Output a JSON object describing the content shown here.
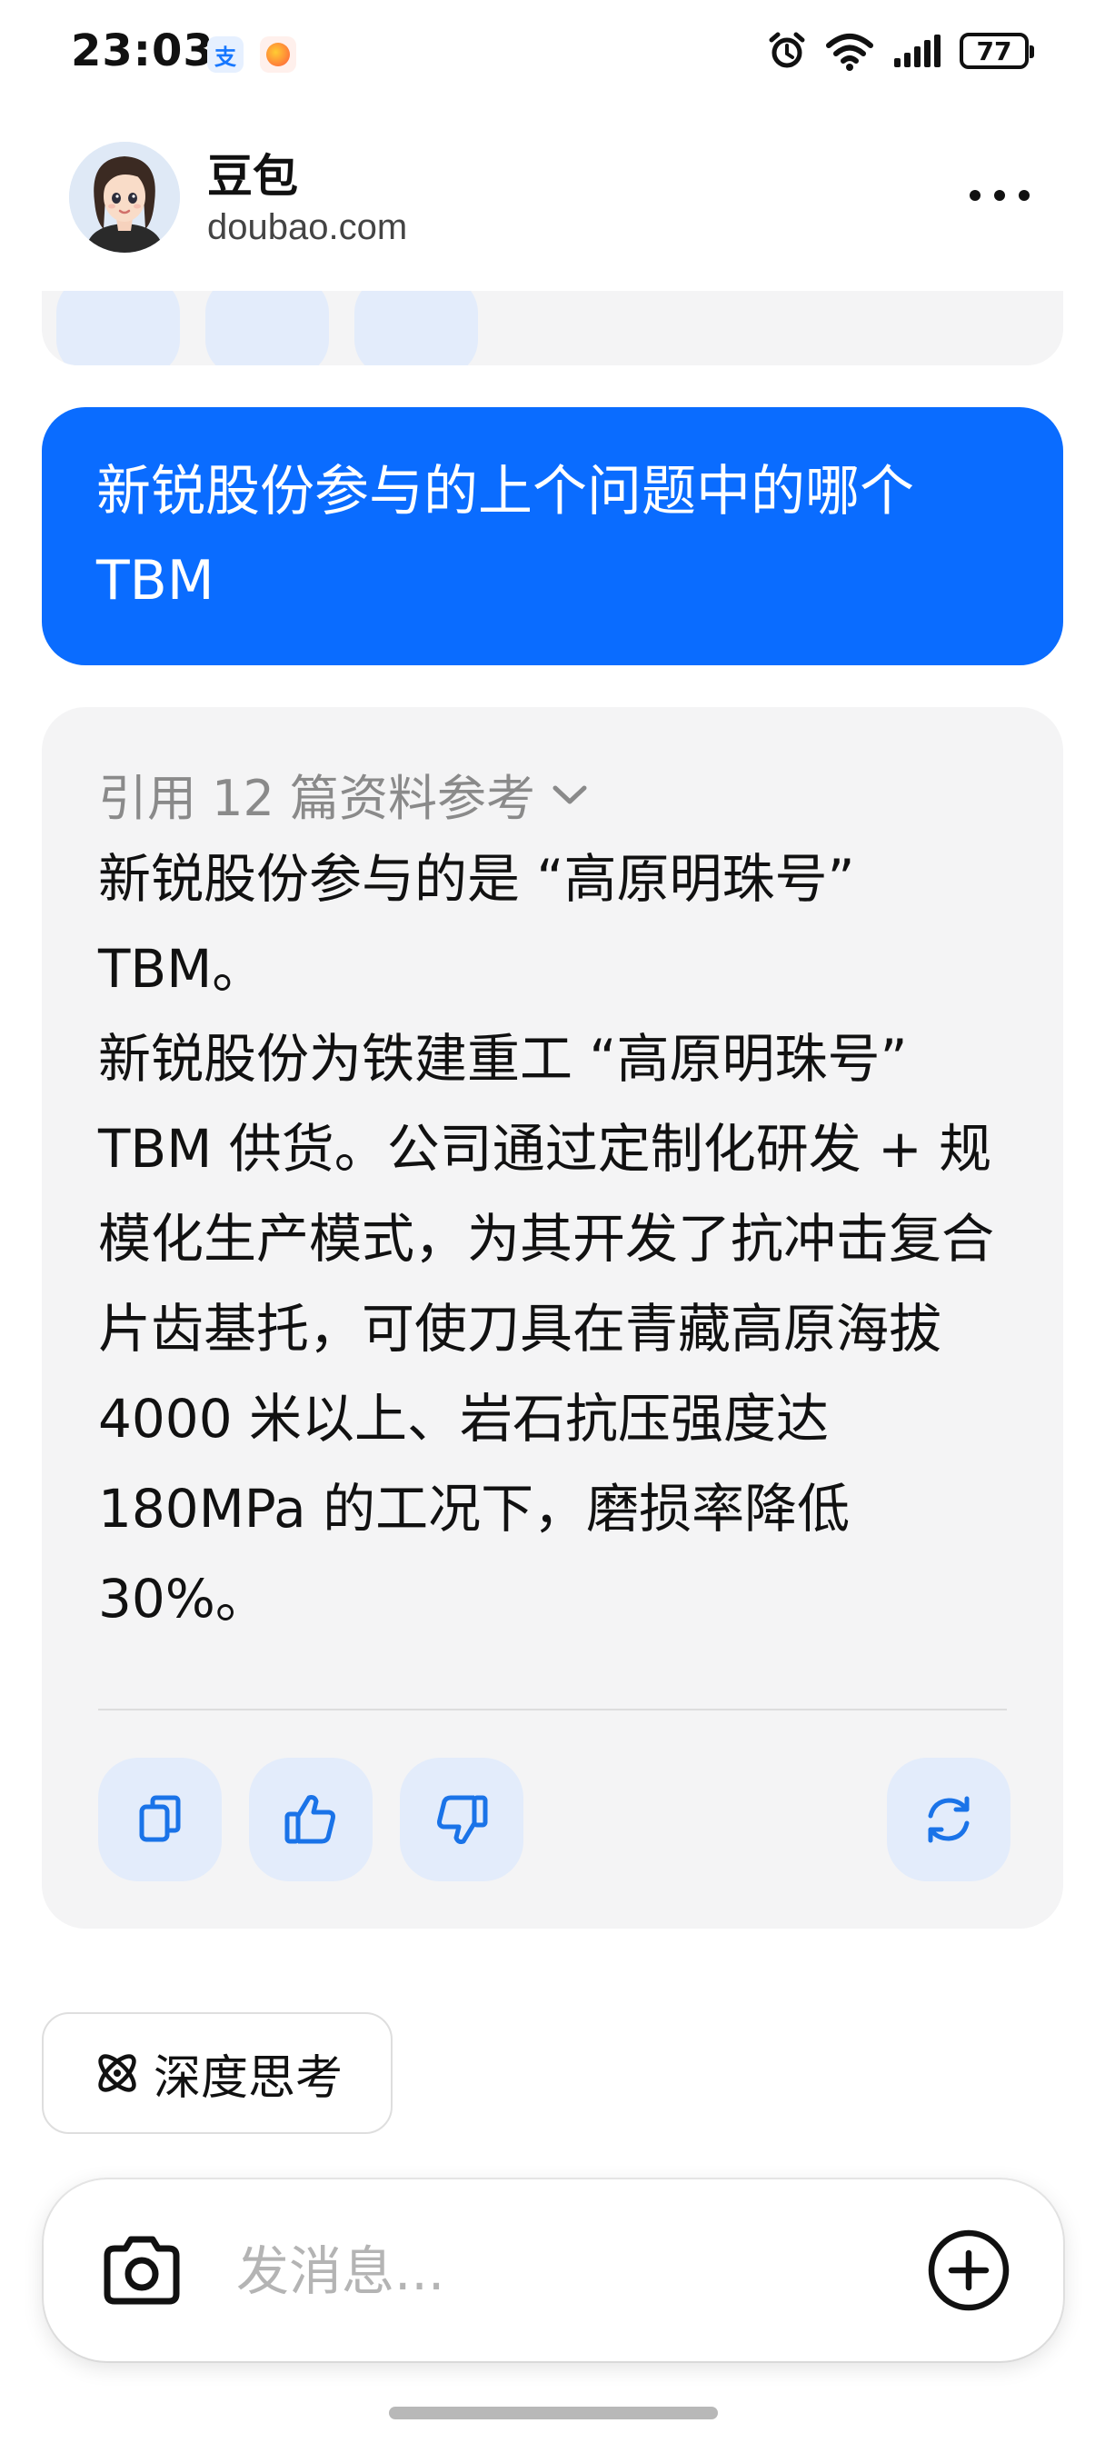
{
  "status_bar": {
    "time": "23:03",
    "app_icons": [
      "alipay-icon",
      "notification-app-icon"
    ],
    "alipay_glyph": "支",
    "battery_level": "77",
    "icons": [
      "alarm-icon",
      "wifi-icon",
      "signal-icon",
      "battery-icon"
    ]
  },
  "header": {
    "title": "豆包",
    "subtitle": "doubao.com",
    "more_icon": "more-icon"
  },
  "conversation": {
    "user_message": "新锐股份参与的上个问题中的哪个 TBM",
    "references_label": "引用 12 篇资料参考",
    "answer_paragraphs": [
      "新锐股份参与的是 “高原明珠号” TBM。",
      "新锐股份为铁建重工 “高原明珠号” TBM 供货。公司通过定制化研发 + 规模化生产模式，为其开发了抗冲击复合片齿基托，可使刀具在青藏高原海拔 4000 米以上、岩石抗压强度达 180MPa 的工况下，磨损率降低 30%。"
    ],
    "actions": [
      "copy-icon",
      "thumbs-up-icon",
      "thumbs-down-icon",
      "regenerate-icon"
    ]
  },
  "deep_think": {
    "label": "深度思考",
    "icon": "atom-icon"
  },
  "composer": {
    "placeholder": "发消息...",
    "value": ""
  },
  "colors": {
    "accent": "#0a6cff",
    "card_bg": "#f4f4f5",
    "action_bg": "#e3ecfb",
    "icon_blue": "#1a73e8"
  }
}
